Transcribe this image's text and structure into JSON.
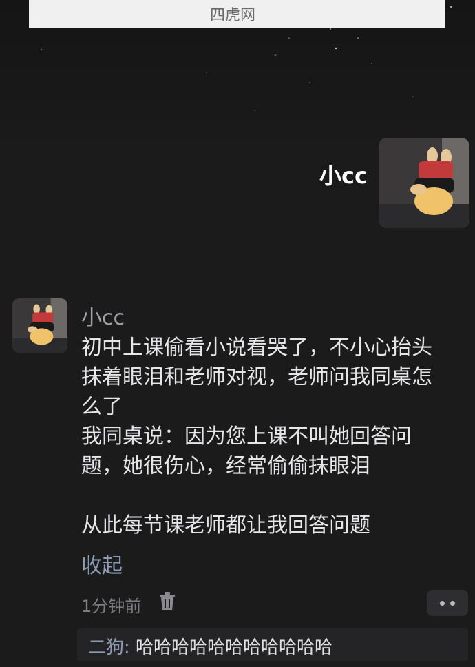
{
  "watermark": {
    "text": "四虎网"
  },
  "profile": {
    "name": "小cc"
  },
  "post": {
    "author": "小cc",
    "body": "初中上课偷看小说看哭了，不小心抬头\n抹着眼泪和老师对视，老师问我同桌怎\n么了\n我同桌说：因为您上课不叫她回答问\n题，她很伤心，经常偷偷抹眼泪\n\n从此每节课老师都让我回答问题",
    "collapse_label": "收起",
    "time": "1分钟前"
  },
  "comment": {
    "author": "二狗",
    "separator": ": ",
    "text": "哈哈哈哈哈哈哈哈哈哈哈"
  },
  "icons": {
    "trash": "trash-icon",
    "more": "more-dots-icon"
  },
  "colors": {
    "background": "#1b1b1c",
    "link": "#8d9ab5"
  }
}
